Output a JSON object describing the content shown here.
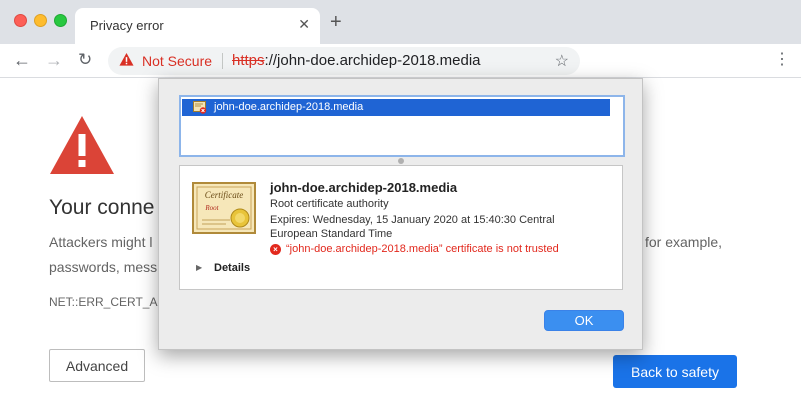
{
  "tab": {
    "title": "Privacy error",
    "close_glyph": "✕",
    "new_tab_glyph": "+"
  },
  "toolbar": {
    "back_glyph": "←",
    "forward_glyph": "→",
    "reload_glyph": "↻",
    "security_label": "Not Secure",
    "url_scheme": "https",
    "url_rest": "://john-doe.archidep-2018.media",
    "star_glyph": "☆",
    "menu_glyph": "⋮"
  },
  "page": {
    "title": "Your conne",
    "body_line1": "Attackers might l",
    "body_line2": "passwords, mess",
    "body_right": "for example,",
    "error_code": "NET::ERR_CERT_A",
    "advanced_label": "Advanced",
    "back_to_safety_label": "Back to safety"
  },
  "dialog": {
    "list_item": "john-doe.archidep-2018.media",
    "cert_name": "john-doe.archidep-2018.media",
    "cert_type": "Root certificate authority",
    "expires_line1": "Expires: Wednesday, 15 January 2020 at 15:40:30 Central",
    "expires_line2": "European Standard Time",
    "error_glyph": "×",
    "error_text": "“john-doe.archidep-2018.media” certificate is not trusted",
    "details_glyph": "▶",
    "details_label": "Details",
    "ok_label": "OK",
    "cert_image_text": "Certificate",
    "cert_image_sub": "Root"
  },
  "colors": {
    "danger": "#d93025",
    "primary": "#1a73e8",
    "selection": "#1f64d4"
  },
  "icons": [
    "warning-icon",
    "star-icon",
    "certificate-icon",
    "error-icon"
  ]
}
